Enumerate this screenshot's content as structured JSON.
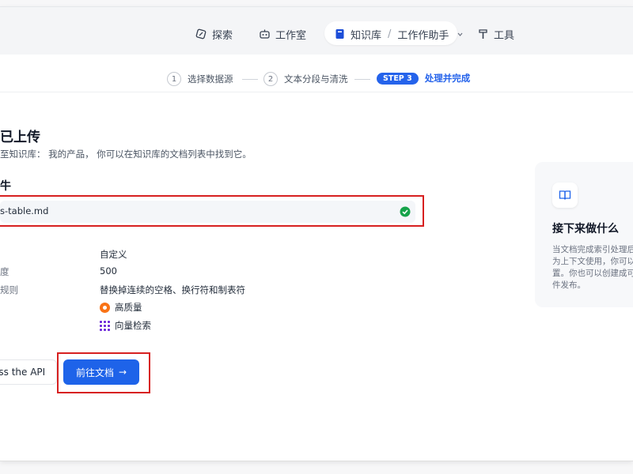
{
  "nav": {
    "explore": "探索",
    "studio": "工作室",
    "knowledge": "知识库",
    "separator": "/",
    "workspace": "工作作助手",
    "tools": "工具"
  },
  "stepper": {
    "step1_num": "1",
    "step1_label": "选择数据源",
    "step2_num": "2",
    "step2_label": "文本分段与清洗",
    "step3_badge": "STEP 3",
    "step3_label": "处理并完成"
  },
  "main": {
    "title": "已上传",
    "subtitle": "至知识库： 我的产品， 你可以在知识库的文档列表中找到它。",
    "file_heading": "牛",
    "file_name": "s-table.md",
    "rows": [
      {
        "label": "",
        "value": "自定义"
      },
      {
        "label": "度",
        "value": "500"
      },
      {
        "label": "规则",
        "value": "替换掉连续的空格、换行符和制表符"
      },
      {
        "label": "",
        "value": "高质量"
      },
      {
        "label": "",
        "value": "向量检索"
      }
    ]
  },
  "buttons": {
    "api_label": "ess the API",
    "go_docs_label": "前往文档",
    "arrow": "→"
  },
  "side": {
    "title": "接下来做什么",
    "lines": [
      "当文档完成索引处理后",
      "为上下文使用，你可以",
      "置。你也可以创建成可",
      "件发布。"
    ]
  },
  "colors": {
    "accent": "#1e63e9",
    "highlight": "#d72020",
    "success": "#16a34a"
  }
}
